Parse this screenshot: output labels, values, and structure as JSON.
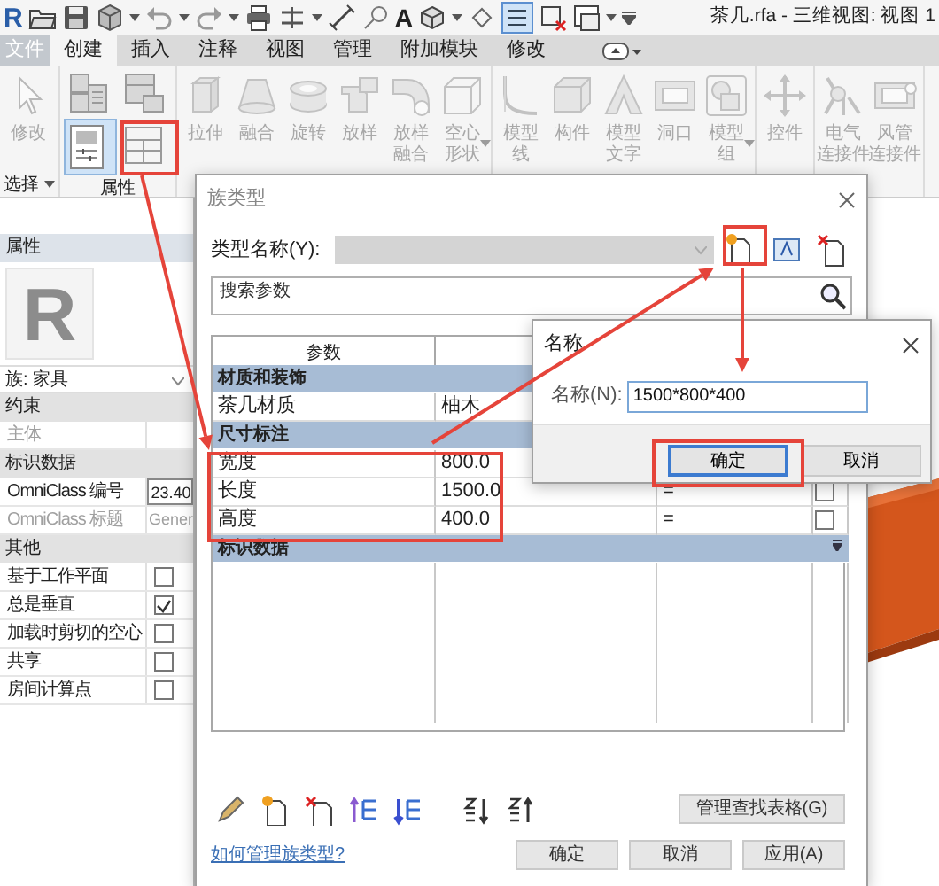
{
  "app": {
    "logo": "R",
    "text_tool": "A",
    "title": "茶几.rfa - 三维视图: 视图 1"
  },
  "ribbon": {
    "disabled": true,
    "tabs": [
      {
        "label": "文件",
        "kind": "file",
        "selected": false
      },
      {
        "label": "创建",
        "kind": "tab",
        "selected": true
      },
      {
        "label": "插入",
        "kind": "tab",
        "selected": false
      },
      {
        "label": "注释",
        "kind": "tab",
        "selected": false
      },
      {
        "label": "视图",
        "kind": "tab",
        "selected": false
      },
      {
        "label": "管理",
        "kind": "tab",
        "selected": false
      },
      {
        "label": "附加模块",
        "kind": "tab",
        "selected": false
      },
      {
        "label": "修改",
        "kind": "tab",
        "selected": false
      }
    ],
    "panels": [
      {
        "kind": "large",
        "label": "选择",
        "dropdown": true,
        "tools": [
          {
            "lines": [
              "修改"
            ]
          }
        ]
      },
      {
        "kind": "grid",
        "label": "属性",
        "tools": [
          {
            "selected": false
          },
          {
            "selected": false
          },
          {
            "selected": true
          },
          {
            "selected": false
          }
        ]
      },
      {
        "kind": "large",
        "tools": [
          {
            "lines": [
              "拉伸"
            ]
          },
          {
            "lines": [
              "融合"
            ]
          },
          {
            "lines": [
              "旋转"
            ]
          },
          {
            "lines": [
              "放样"
            ]
          },
          {
            "lines": [
              "放样",
              "融合"
            ]
          },
          {
            "lines": [
              "空心",
              "形状"
            ],
            "dropdown": true
          }
        ]
      },
      {
        "kind": "large",
        "tools": [
          {
            "lines": [
              "模型",
              "线"
            ]
          },
          {
            "lines": [
              "构件"
            ]
          },
          {
            "lines": [
              "模型",
              "文字"
            ]
          },
          {
            "lines": [
              "洞口"
            ]
          },
          {
            "lines": [
              "模型",
              "组"
            ],
            "dropdown": true
          }
        ]
      },
      {
        "kind": "large",
        "tools": [
          {
            "lines": [
              "控件"
            ]
          }
        ]
      },
      {
        "kind": "large",
        "tools": [
          {
            "lines": [
              "电气",
              "连接件"
            ]
          },
          {
            "lines": [
              "风管",
              "连接件"
            ]
          }
        ]
      }
    ]
  },
  "properties": {
    "title": "属性",
    "preview_glyph": "R",
    "family": "族: 家具",
    "groups": [
      {
        "name": "约束",
        "rows": [
          {
            "kind": "text",
            "label": "主体",
            "disabled": true
          }
        ]
      },
      {
        "name": "标识数据",
        "rows": [
          {
            "kind": "text",
            "label": "OmniClass 编号",
            "value": "23.40",
            "disabled": false
          },
          {
            "kind": "text",
            "label": "OmniClass 标题",
            "value": "Gener",
            "disabled": true
          }
        ]
      },
      {
        "name": "其他",
        "rows": [
          {
            "kind": "checkbox",
            "label": "基于工作平面",
            "checked": false
          },
          {
            "kind": "checkbox",
            "label": "总是垂直",
            "checked": true
          },
          {
            "kind": "checkbox",
            "label": "加载时剪切的空心",
            "checked": false
          },
          {
            "kind": "checkbox",
            "label": "共享",
            "checked": false
          },
          {
            "kind": "checkbox",
            "label": "房间计算点",
            "checked": false
          }
        ]
      }
    ]
  },
  "family_types_dialog": {
    "title": "族类型",
    "type_name_label": "类型名称(Y):",
    "search_placeholder": "搜索参数",
    "columns": [
      "参数"
    ],
    "groups": [
      {
        "name": "材质和装饰",
        "rows": [
          {
            "parameter": "茶几材质",
            "value": "柚木"
          }
        ]
      },
      {
        "name": "尺寸标注",
        "rows": [
          {
            "parameter": "宽度",
            "value": "800.0"
          },
          {
            "parameter": "长度",
            "value": "1500.0",
            "formula": "=",
            "locked": false
          },
          {
            "parameter": "高度",
            "value": "400.0",
            "formula": "=",
            "locked": false
          }
        ]
      },
      {
        "name": "标识数据",
        "collapse_mark": true
      }
    ],
    "manage_lookup_button": "管理查找表格(G)",
    "help_link": "如何管理族类型?",
    "buttons": [
      "确定",
      "取消",
      "应用(A)"
    ]
  },
  "name_dialog": {
    "title": "名称",
    "field_label": "名称(N):",
    "value": "1500*800*400",
    "buttons": [
      {
        "label": "确定",
        "default": true
      },
      {
        "label": "取消",
        "default": false
      }
    ]
  }
}
